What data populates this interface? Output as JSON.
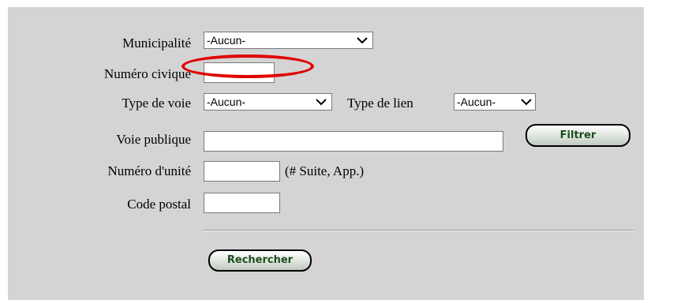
{
  "form": {
    "municipalite": {
      "label": "Municipalité",
      "value": "-Aucun-"
    },
    "numero_civique": {
      "label": "Numéro civique",
      "value": ""
    },
    "type_voie": {
      "label": "Type de voie",
      "value": "-Aucun-"
    },
    "type_lien": {
      "label": "Type de lien",
      "value": "-Aucun-"
    },
    "voie_publique": {
      "label": "Voie publique",
      "value": ""
    },
    "numero_unite": {
      "label": "Numéro d'unité",
      "value": "",
      "hint": "(# Suite, App.)"
    },
    "code_postal": {
      "label": "Code postal",
      "value": ""
    },
    "filtrer_label": "Filtrer",
    "rechercher_label": "Rechercher"
  },
  "colors": {
    "panel_bg": "#d4d4d4",
    "annotation_ring": "#e00000",
    "button_text": "#1b4d1b"
  },
  "icons": {
    "dropdown": "chevron-down-icon"
  }
}
